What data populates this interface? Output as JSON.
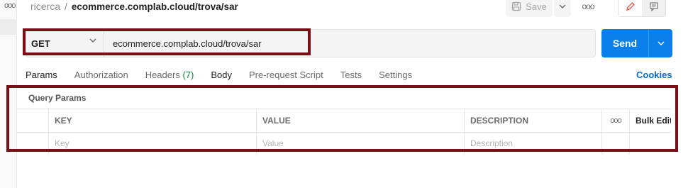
{
  "breadcrumb": {
    "parent": "ricerca",
    "separator": "/",
    "current": "ecommerce.complab.cloud/trova/sar"
  },
  "toolbar": {
    "save_label": "Save",
    "save_icon": "save-icon",
    "caret_icon": "chevron-down-icon",
    "more_label": "ooo",
    "edit_icon": "pencil-icon",
    "comment_icon": "comment-icon"
  },
  "sidebar": {
    "more_label": "ooo"
  },
  "request": {
    "method": "GET",
    "url": "ecommerce.complab.cloud/trova/sar",
    "send_label": "Send"
  },
  "tabs": [
    {
      "label": "Params"
    },
    {
      "label": "Authorization"
    },
    {
      "label": "Headers",
      "count": "(7)"
    },
    {
      "label": "Body"
    },
    {
      "label": "Pre-request Script"
    },
    {
      "label": "Tests"
    },
    {
      "label": "Settings"
    }
  ],
  "cookies_label": "Cookies",
  "query_params": {
    "title": "Query Params",
    "headers": {
      "key": "KEY",
      "value": "VALUE",
      "description": "DESCRIPTION",
      "more": "ooo",
      "bulk_edit": "Bulk Edit"
    },
    "placeholders": {
      "key": "Key",
      "value": "Value",
      "description": "Description"
    }
  },
  "colors": {
    "accent": "#0b80ea",
    "highlight": "#7a0f16",
    "count_green": "#0e8a3a",
    "edit_icon": "#e5533d"
  }
}
